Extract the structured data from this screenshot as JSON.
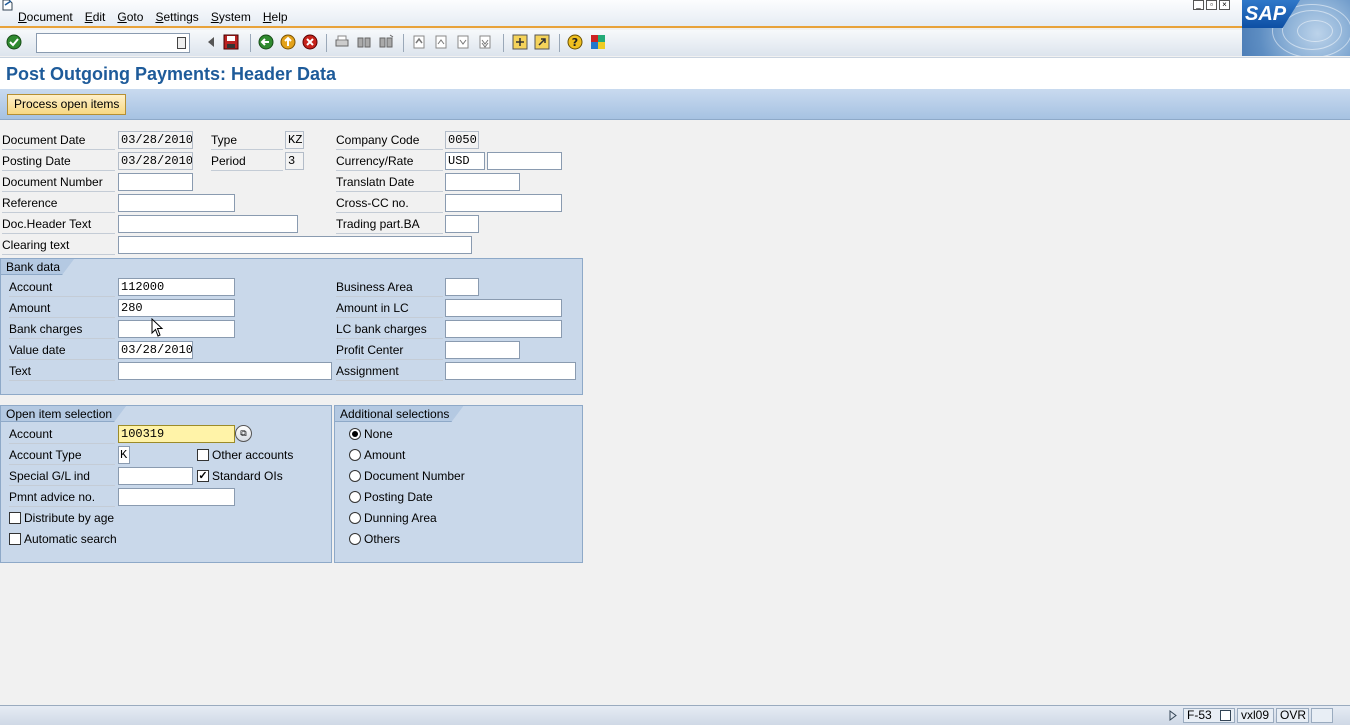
{
  "menu": [
    "Document",
    "Edit",
    "Goto",
    "Settings",
    "System",
    "Help"
  ],
  "sap_logo_text": "SAP",
  "toolbar": {
    "command_field_value": "",
    "icons": [
      "enter-icon",
      "back-arrow-icon",
      "save-icon",
      "back-icon",
      "exit-icon",
      "cancel-icon",
      "print-icon",
      "find-icon",
      "find-next-icon",
      "first-page-icon",
      "previous-page-icon",
      "next-page-icon",
      "last-page-icon",
      "create-session-icon",
      "shortcut-icon",
      "help-icon",
      "customize-layout-icon"
    ]
  },
  "title": "Post Outgoing Payments: Header Data",
  "app_toolbar": {
    "process_open_items": "Process open items"
  },
  "header": {
    "document_date": {
      "label": "Document Date",
      "value": "03/28/2010"
    },
    "posting_date": {
      "label": "Posting Date",
      "value": "03/28/2010"
    },
    "document_number": {
      "label": "Document Number",
      "value": ""
    },
    "reference": {
      "label": "Reference",
      "value": ""
    },
    "doc_header_text": {
      "label": "Doc.Header Text",
      "value": ""
    },
    "clearing_text": {
      "label": "Clearing text",
      "value": ""
    },
    "type": {
      "label": "Type",
      "value": "KZ"
    },
    "period": {
      "label": "Period",
      "value": "3"
    },
    "company_code": {
      "label": "Company Code",
      "value": "0050"
    },
    "currency_rate": {
      "label": "Currency/Rate",
      "value": "USD",
      "rate": ""
    },
    "translatn_date": {
      "label": "Translatn Date",
      "value": ""
    },
    "cross_cc": {
      "label": "Cross-CC no.",
      "value": ""
    },
    "trading_part": {
      "label": "Trading part.BA",
      "value": ""
    }
  },
  "bank_data": {
    "title": "Bank data",
    "account": {
      "label": "Account",
      "value": "112000"
    },
    "amount": {
      "label": "Amount",
      "value": "280"
    },
    "bank_charges": {
      "label": "Bank charges",
      "value": ""
    },
    "value_date": {
      "label": "Value date",
      "value": "03/28/2010"
    },
    "text": {
      "label": "Text",
      "value": ""
    },
    "business_area": {
      "label": "Business Area",
      "value": ""
    },
    "amount_lc": {
      "label": "Amount in LC",
      "value": ""
    },
    "lc_bank_charges": {
      "label": "LC bank charges",
      "value": ""
    },
    "profit_center": {
      "label": "Profit Center",
      "value": ""
    },
    "assignment": {
      "label": "Assignment",
      "value": ""
    }
  },
  "open_item_selection": {
    "title": "Open item selection",
    "account": {
      "label": "Account",
      "value": "100319"
    },
    "account_type": {
      "label": "Account Type",
      "value": "K"
    },
    "special_gl": {
      "label": "Special G/L ind",
      "value": ""
    },
    "pmnt_advice": {
      "label": "Pmnt advice no.",
      "value": ""
    },
    "other_accounts": {
      "label": "Other accounts",
      "checked": false
    },
    "standard_ois": {
      "label": "Standard OIs",
      "checked": true
    },
    "distribute_by_age": {
      "label": "Distribute by age",
      "checked": false
    },
    "automatic_search": {
      "label": "Automatic search",
      "checked": false
    }
  },
  "additional_selections": {
    "title": "Additional selections",
    "options": [
      "None",
      "Amount",
      "Document Number",
      "Posting Date",
      "Dunning Area",
      "Others"
    ],
    "selected": "None"
  },
  "status": {
    "transaction": "F-53",
    "server": "vxl09",
    "mode": "OVR"
  }
}
